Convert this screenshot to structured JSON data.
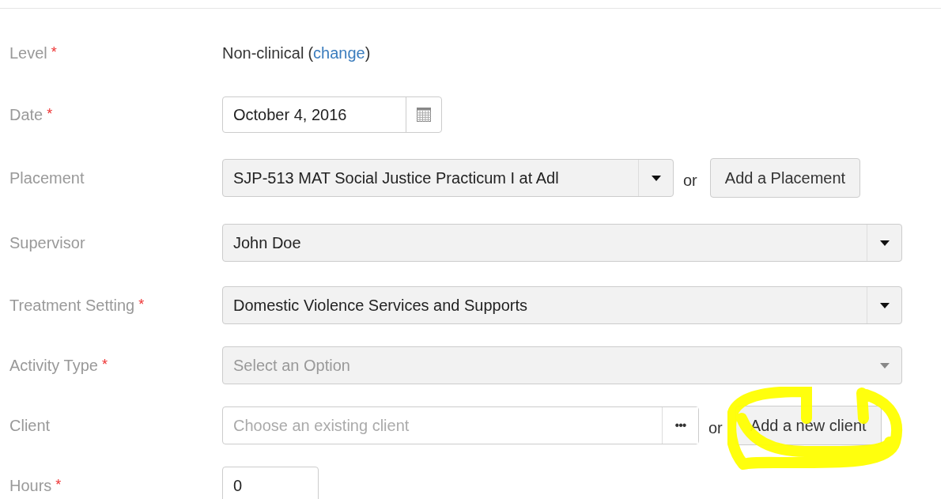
{
  "fields": [
    {
      "kind": "text",
      "label": "Level",
      "mark": "*",
      "value": "Non-clinical",
      "open": "(",
      "link": "change",
      "close": ")"
    },
    {
      "kind": "date",
      "label": "Date",
      "mark": "*",
      "value": "October 4, 2016"
    },
    {
      "kind": "select",
      "label": "Placement",
      "value": "SJP-513 MAT Social Justice Practicum I at Adl",
      "or": "or",
      "button": "Add a Placement"
    },
    {
      "kind": "select",
      "label": "Supervisor",
      "value": "John Doe"
    },
    {
      "kind": "select",
      "label": "Treatment Setting",
      "mark": "*",
      "value": "Domestic Violence Services and Supports"
    },
    {
      "kind": "select",
      "label": "Activity Type",
      "mark": "*",
      "placeholder": "Select an Option"
    },
    {
      "kind": "combo",
      "label": "Client",
      "placeholder": "Choose an existing client",
      "picker": "•••",
      "or": "or",
      "button": "Add a new client",
      "highlighted": true
    },
    {
      "kind": "number",
      "label": "Hours",
      "mark": "*",
      "value": "0"
    }
  ]
}
